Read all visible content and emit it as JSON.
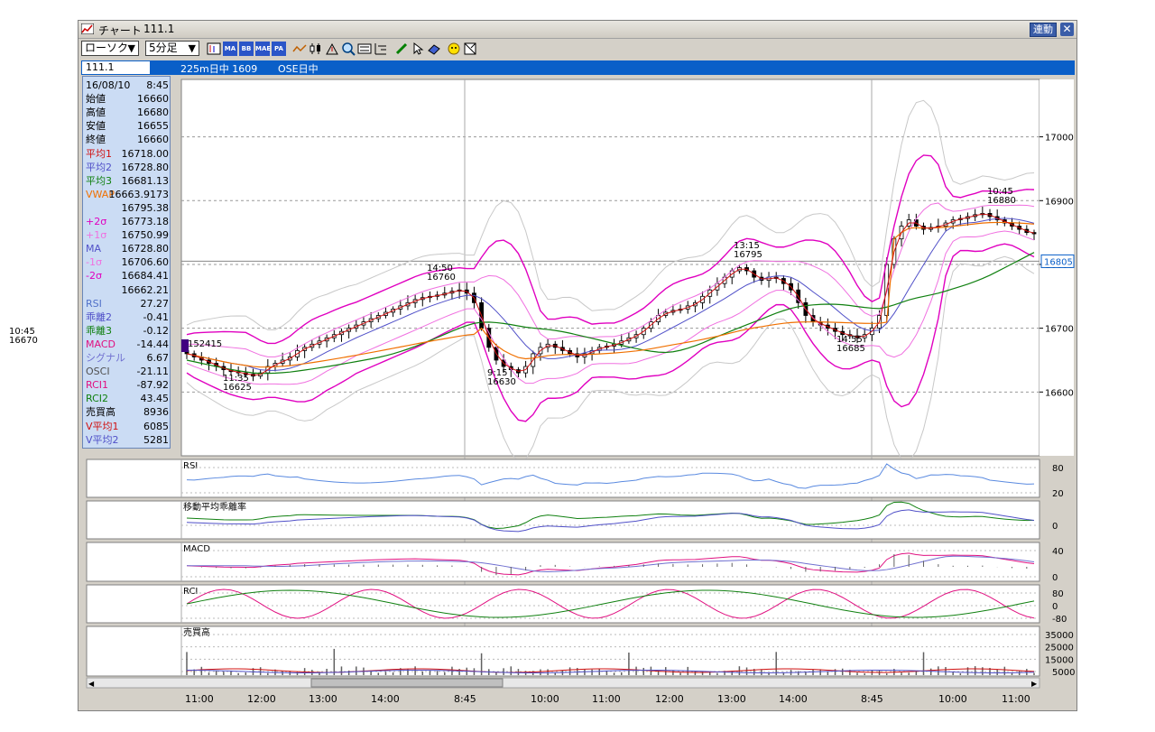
{
  "window": {
    "title": "チャート",
    "symbol_title": "111.1",
    "link_button": "連動",
    "close_glyph": "✕"
  },
  "toolbar": {
    "chart_type": "ローソク",
    "interval": "5分足",
    "dropdown_glyph": "▼",
    "icons": [
      "chart-settings-icon",
      "ma-icon",
      "bb-icon",
      "mae-icon",
      "pa-icon",
      "line-icon",
      "candle-icon",
      "zoom-icon",
      "search-icon",
      "scale-icon",
      "pen-icon",
      "cursor-icon",
      "eraser-icon",
      "smile-icon",
      "print-icon"
    ],
    "icon_labels": {
      "ma": "MA",
      "bb": "BB",
      "mae": "MAE",
      "pa": "PA"
    }
  },
  "infobar": {
    "symbol_input": "111.1",
    "instrument": "225m日中 1609",
    "session": "OSE日中"
  },
  "data_panel": {
    "rows": [
      {
        "label": "16/08/10",
        "value": "8:45",
        "color": "#000000"
      },
      {
        "label": "始値",
        "value": "16660",
        "color": "#000000"
      },
      {
        "label": "高値",
        "value": "16680",
        "color": "#000000"
      },
      {
        "label": "安値",
        "value": "16655",
        "color": "#000000"
      },
      {
        "label": "終値",
        "value": "16660",
        "color": "#000000"
      },
      {
        "label": "平均1",
        "value": "16718.00",
        "color": "#d01010"
      },
      {
        "label": "平均2",
        "value": "16728.80",
        "color": "#5050c8"
      },
      {
        "label": "平均3",
        "value": "16681.13",
        "color": "#108010"
      },
      {
        "label": "VWAP",
        "value": "16663.9173",
        "color": "#f07000"
      },
      {
        "label": "",
        "value": "16795.38",
        "color": "#000000"
      },
      {
        "label": "+2σ",
        "value": "16773.18",
        "color": "#e000c0"
      },
      {
        "label": "+1σ",
        "value": "16750.99",
        "color": "#f070e0"
      },
      {
        "label": "MA",
        "value": "16728.80",
        "color": "#5050c8"
      },
      {
        "label": "-1σ",
        "value": "16706.60",
        "color": "#f070e0"
      },
      {
        "label": "-2σ",
        "value": "16684.41",
        "color": "#e000c0"
      },
      {
        "label": "",
        "value": "16662.21",
        "color": "#000000"
      },
      {
        "label": "RSI",
        "value": "27.27",
        "color": "#5070c8"
      },
      {
        "label": "乖離2",
        "value": "-0.41",
        "color": "#5050c8"
      },
      {
        "label": "乖離3",
        "value": "-0.12",
        "color": "#108010"
      },
      {
        "label": "MACD",
        "value": "-14.44",
        "color": "#e01080"
      },
      {
        "label": "シグナル",
        "value": "6.67",
        "color": "#7070d0"
      },
      {
        "label": "OSCI",
        "value": "-21.11",
        "color": "#505050"
      },
      {
        "label": "RCI1",
        "value": "-87.92",
        "color": "#e01080"
      },
      {
        "label": "RCI2",
        "value": "43.45",
        "color": "#108010"
      },
      {
        "label": "売買高",
        "value": "8936",
        "color": "#000000"
      },
      {
        "label": "V平均1",
        "value": "6085",
        "color": "#d01010"
      },
      {
        "label": "V平均2",
        "value": "5281",
        "color": "#5050c8"
      }
    ]
  },
  "chart_data": [
    {
      "type": "candlestick",
      "title": "",
      "x": [
        "11:00",
        "12:00",
        "13:00",
        "14:00",
        "8:45",
        "10:00",
        "11:00",
        "12:00",
        "13:00",
        "14:00",
        "8:45",
        "10:00",
        "11:00"
      ],
      "y_ticks": [
        17000,
        16900,
        16800,
        16700,
        16600
      ],
      "ylim": [
        16500,
        17090
      ],
      "current_price": "16805",
      "annotations": [
        {
          "time": "10:45",
          "price": "16670"
        },
        {
          "time": "11:35",
          "price": "16625"
        },
        {
          "time": "14:50",
          "price": "16760"
        },
        {
          "time": "9:15",
          "price": "16630"
        },
        {
          "time": "13:15",
          "price": "16795"
        },
        {
          "time": "14:55",
          "price": "16685"
        },
        {
          "time": "10:45",
          "price": "16880"
        }
      ],
      "left_marker": "152415",
      "close_series": [
        16660,
        16655,
        16650,
        16645,
        16640,
        16635,
        16632,
        16630,
        16628,
        16625,
        16630,
        16640,
        16645,
        16650,
        16655,
        16665,
        16670,
        16675,
        16680,
        16685,
        16690,
        16695,
        16700,
        16705,
        16710,
        16715,
        16720,
        16725,
        16730,
        16735,
        16740,
        16745,
        16748,
        16750,
        16752,
        16755,
        16758,
        16760,
        16755,
        16740,
        16700,
        16670,
        16650,
        16640,
        16635,
        16630,
        16640,
        16660,
        16670,
        16675,
        16670,
        16665,
        16660,
        16655,
        16660,
        16665,
        16670,
        16672,
        16675,
        16680,
        16685,
        16690,
        16700,
        16710,
        16720,
        16725,
        16728,
        16730,
        16735,
        16740,
        16750,
        16760,
        16770,
        16780,
        16790,
        16795,
        16790,
        16780,
        16775,
        16780,
        16778,
        16770,
        16760,
        16740,
        16720,
        16710,
        16705,
        16700,
        16695,
        16690,
        16688,
        16685,
        16690,
        16700,
        16720,
        16800,
        16840,
        16860,
        16870,
        16860,
        16855,
        16858,
        16860,
        16865,
        16870,
        16872,
        16875,
        16878,
        16880,
        16875,
        16870,
        16865,
        16860,
        16855,
        16850,
        16848
      ]
    },
    {
      "type": "line",
      "title": "RSI",
      "y_ticks": [
        80,
        20
      ]
    },
    {
      "type": "line",
      "title": "移動平均乖離率",
      "y_ticks": [
        0
      ]
    },
    {
      "type": "line",
      "title": "MACD",
      "y_ticks": [
        40,
        0
      ]
    },
    {
      "type": "line",
      "title": "RCI",
      "y_ticks": [
        80,
        0,
        -80
      ]
    },
    {
      "type": "bar",
      "title": "売買高",
      "y_ticks": [
        35000,
        25000,
        15000,
        5000
      ]
    }
  ],
  "colors": {
    "ma1": "#d01010",
    "ma2": "#5050c8",
    "ma3": "#108010",
    "vwap": "#f07000",
    "band2": "#e000c0",
    "band1": "#f070e0",
    "band3": "#c8c8c8",
    "accent": "#0a5fc8"
  }
}
